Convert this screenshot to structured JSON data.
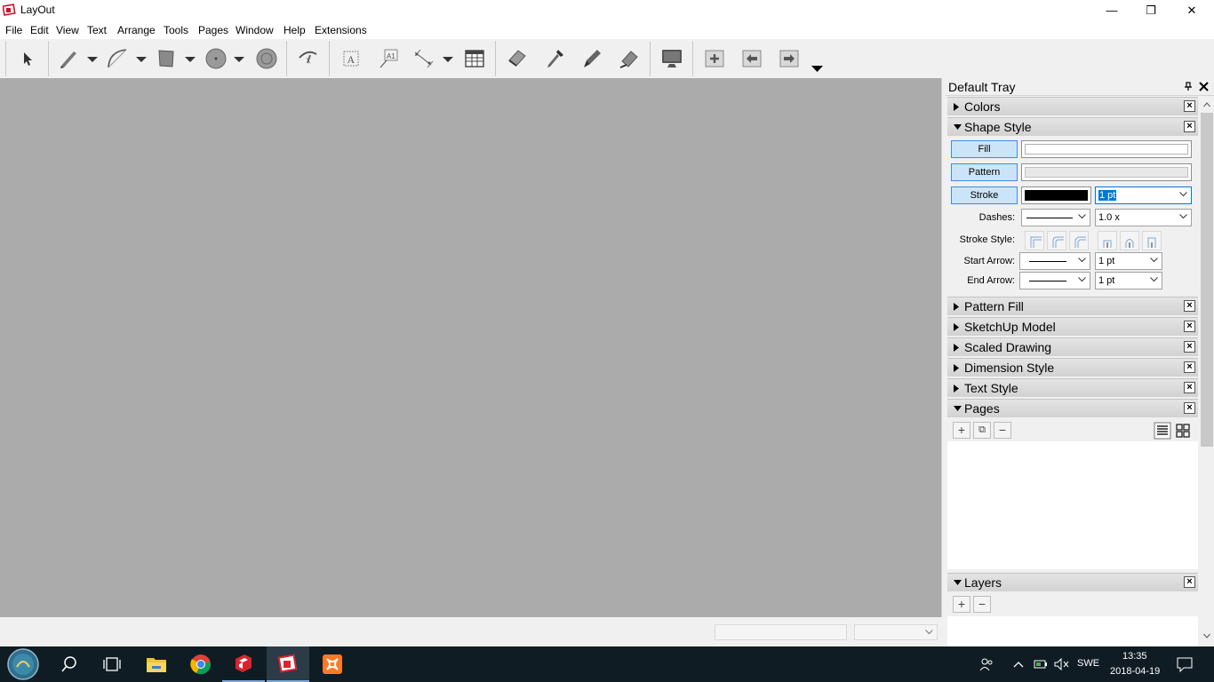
{
  "window": {
    "title": "LayOut",
    "minimize": "—",
    "restore": "❐",
    "close": "✕"
  },
  "menu": [
    "File",
    "Edit",
    "View",
    "Text",
    "Arrange",
    "Tools",
    "Pages",
    "Window",
    "Help",
    "Extensions"
  ],
  "toolbar": {
    "tools": [
      "select-tool",
      "line-tool",
      "arc-tool",
      "rectangle-tool",
      "circle-tool",
      "polygon-tool",
      "split-tool",
      "text-tool",
      "label-tool",
      "dimension-tool",
      "table-tool",
      "eraser-tool",
      "style-tool",
      "sample-tool",
      "join-tool",
      "presentation-tool",
      "add-page-tool",
      "previous-page-tool",
      "next-page-tool"
    ]
  },
  "tray": {
    "title": "Default Tray",
    "pin": "📌",
    "close": "✕",
    "panels": {
      "colors": "Colors",
      "shape_style": "Shape Style",
      "pattern_fill": "Pattern Fill",
      "sketchup_model": "SketchUp Model",
      "scaled_drawing": "Scaled Drawing",
      "dimension_style": "Dimension Style",
      "text_style": "Text Style",
      "pages": "Pages",
      "layers": "Layers"
    },
    "shape_style": {
      "fill_label": "Fill",
      "pattern_label": "Pattern",
      "stroke_label": "Stroke",
      "stroke_width": "1 pt",
      "dashes_label": "Dashes:",
      "dash_scale": "1.0 x",
      "stroke_style_label": "Stroke Style:",
      "start_arrow_label": "Start Arrow:",
      "start_arrow_size": "1 pt",
      "end_arrow_label": "End Arrow:",
      "end_arrow_size": "1 pt",
      "stroke_color": "#000000",
      "fill_color": "#ffffff",
      "pattern_color": "#e8e8e8"
    },
    "pages_buttons": {
      "add": "+",
      "duplicate": "⧉",
      "remove": "−"
    },
    "layers_buttons": {
      "add": "+",
      "remove": "−"
    }
  },
  "taskbar": {
    "apps": [
      "start-button",
      "search-button",
      "task-view-button",
      "file-explorer",
      "chrome",
      "sketchup",
      "layout",
      "xampp"
    ],
    "language": "SWE",
    "time": "13:35",
    "date": "2018-04-19"
  },
  "colors": {
    "canvas": "#ababab",
    "accent_blue": "#cce4f7",
    "accent_border": "#3c8ce0",
    "taskbar": "#101c24"
  }
}
